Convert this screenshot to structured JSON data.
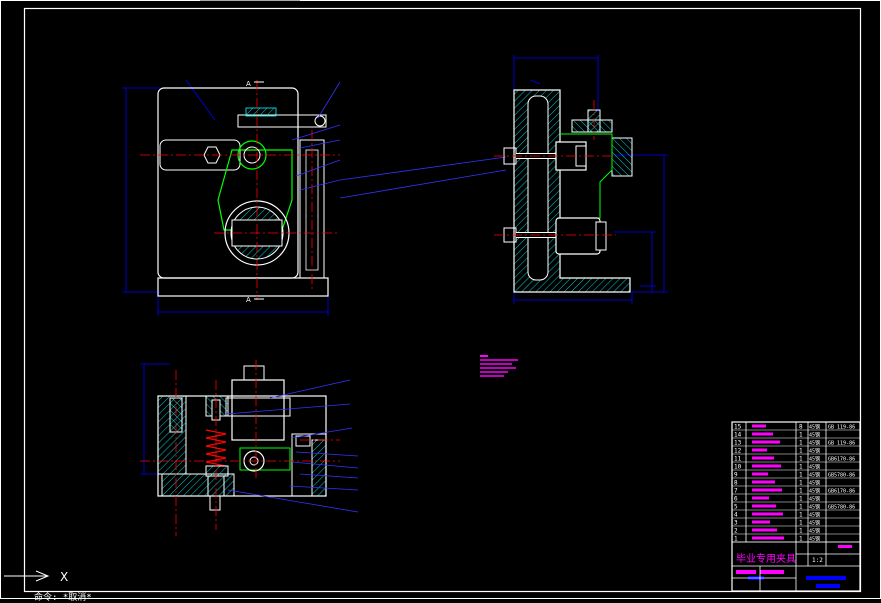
{
  "drawing": {
    "title_block": {
      "main_title": "毕业专用夹具",
      "item_numbers": [
        "15",
        "14",
        "13",
        "12",
        "11",
        "10",
        "9",
        "8",
        "7",
        "6",
        "5",
        "4",
        "3",
        "2",
        "1"
      ],
      "quantities": [
        "8",
        "1",
        "1",
        "1",
        "1",
        "1",
        "1",
        "1",
        "1",
        "1",
        "1",
        "1",
        "1",
        "1",
        "1"
      ],
      "materials": [
        "45钢",
        "45钢",
        "45钢",
        "45钢",
        "45钢",
        "45钢",
        "45钢",
        "45钢",
        "45钢",
        "45钢",
        "45钢",
        "45钢",
        "45钢",
        "45钢",
        "45钢"
      ],
      "standards": [
        "GB 119-86",
        "",
        "GB 119-86",
        "",
        "GB6170-86",
        "",
        "GB5780-86",
        "",
        "GB6170-86",
        "",
        "GB5780-86",
        "",
        "",
        "",
        ""
      ],
      "scale": "1:2"
    },
    "section_marks": {
      "top": "A",
      "bottom": "A"
    },
    "ucs_axis_label": "X",
    "command_line": "命令: *取消*"
  },
  "colors": {
    "background": "#000000",
    "outline": "#ffffff",
    "dimension": "#0000ff",
    "centerline": "#ff0000",
    "hatch": "#00ffff",
    "part_green": "#00ff00",
    "text_magenta": "#ff00ff",
    "leader_blue": "#3333ff"
  }
}
